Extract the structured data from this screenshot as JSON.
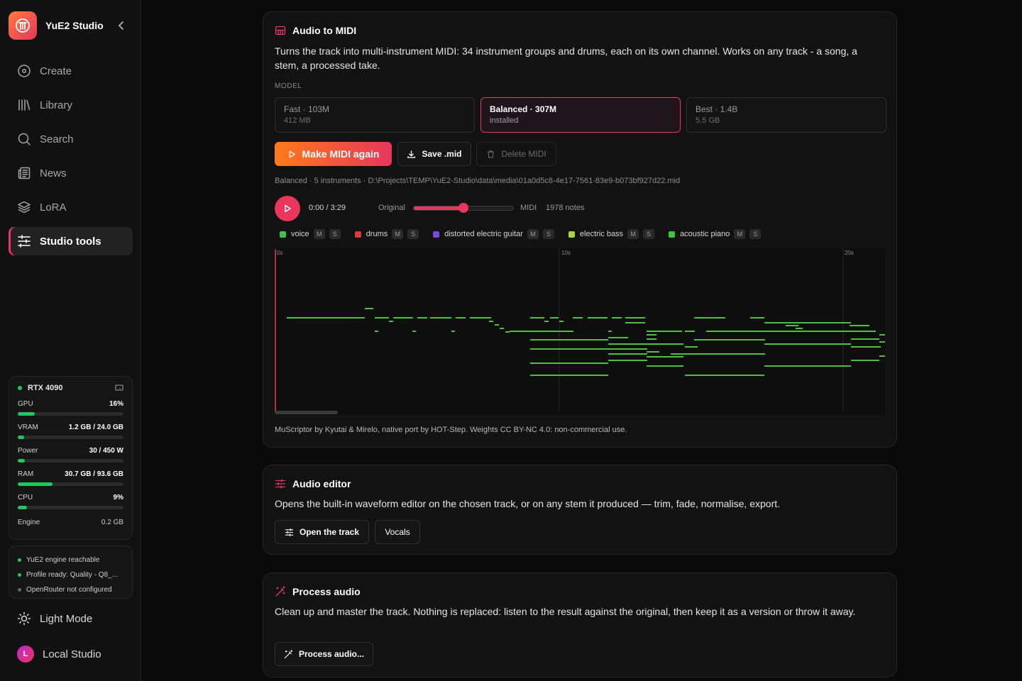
{
  "sidebar": {
    "app_name": "YuE2 Studio",
    "nav": [
      {
        "label": "Create",
        "icon": "disc-icon"
      },
      {
        "label": "Library",
        "icon": "library-icon"
      },
      {
        "label": "Search",
        "icon": "search-icon"
      },
      {
        "label": "News",
        "icon": "newspaper-icon"
      },
      {
        "label": "LoRA",
        "icon": "layers-icon"
      },
      {
        "label": "Studio tools",
        "icon": "sliders-icon",
        "active": true
      }
    ],
    "hardware": {
      "gpu_name": "RTX 4090",
      "metrics": [
        {
          "label": "GPU",
          "value": "16%",
          "fraction": 0.16
        },
        {
          "label": "VRAM",
          "value": "1.2 GB / 24.0 GB",
          "fraction": 0.05
        },
        {
          "label": "Power",
          "value": "30 / 450 W",
          "fraction": 0.07
        },
        {
          "label": "RAM",
          "value": "30.7 GB / 93.6 GB",
          "fraction": 0.33
        },
        {
          "label": "CPU",
          "value": "9%",
          "fraction": 0.09
        }
      ],
      "engine_label": "Engine",
      "engine_value": "0.2 GB"
    },
    "status": [
      {
        "text": "YuE2 engine reachable",
        "state": "ok"
      },
      {
        "text": "Profile ready: Quality - Q8_...",
        "state": "ok"
      },
      {
        "text": "OpenRouter not configured",
        "state": "off"
      }
    ],
    "theme_toggle": "Light Mode",
    "user": {
      "initial": "L",
      "name": "Local Studio"
    }
  },
  "audio_to_midi": {
    "title": "Audio to MIDI",
    "description": "Turns the track into multi-instrument MIDI: 34 instrument groups and drums, each on its own channel. Works on any track - a song, a stem, a processed take.",
    "model_label": "MODEL",
    "models": [
      {
        "name": "Fast · 103M",
        "sub": "412 MB"
      },
      {
        "name": "Balanced · 307M",
        "sub": "installed",
        "selected": true
      },
      {
        "name": "Best · 1.4B",
        "sub": "5.5 GB"
      }
    ],
    "make_button": "Make MIDI again",
    "save_button": "Save .mid",
    "delete_button": "Delete MIDI",
    "file_info": "Balanced · 5 instruments · D:\\Projects\\TEMP\\YuE2-Studio\\data\\media\\01a0d5c8-4e17-7561-83e9-b073bf927d22.mid",
    "player": {
      "time": "0:00 / 3:29",
      "left_label": "Original",
      "right_label": "MIDI",
      "mix": 0.5,
      "notes": "1978 notes"
    },
    "instruments": [
      {
        "name": "voice",
        "color": "#3fc44a"
      },
      {
        "name": "drums",
        "color": "#d63a3a"
      },
      {
        "name": "distorted electric guitar",
        "color": "#7b46e0"
      },
      {
        "name": "electric bass",
        "color": "#a6d63a"
      },
      {
        "name": "acoustic piano",
        "color": "#3fc44a"
      }
    ],
    "mute_label": "M",
    "solo_label": "S",
    "time_markers": [
      "0s",
      "10s",
      "20s"
    ],
    "note_color": "#4fbf3f",
    "credit": "MuScriptor by Kyutai & Mirelo, native port by HOT-Step. Weights CC BY-NC 4.0: non-commercial use."
  },
  "audio_editor": {
    "title": "Audio editor",
    "description": "Opens the built-in waveform editor on the chosen track, or on any stem it produced — trim, fade, normalise, export.",
    "open_button": "Open the track",
    "vocals_button": "Vocals"
  },
  "process_audio": {
    "title": "Process audio",
    "description": "Clean up and master the track. Nothing is replaced: listen to the result against the original, then keep it as a version or throw it away.",
    "button": "Process audio..."
  },
  "colors": {
    "accent": "#e8365d",
    "accent_orange": "#ff7a1a",
    "ok": "#22c55e"
  }
}
